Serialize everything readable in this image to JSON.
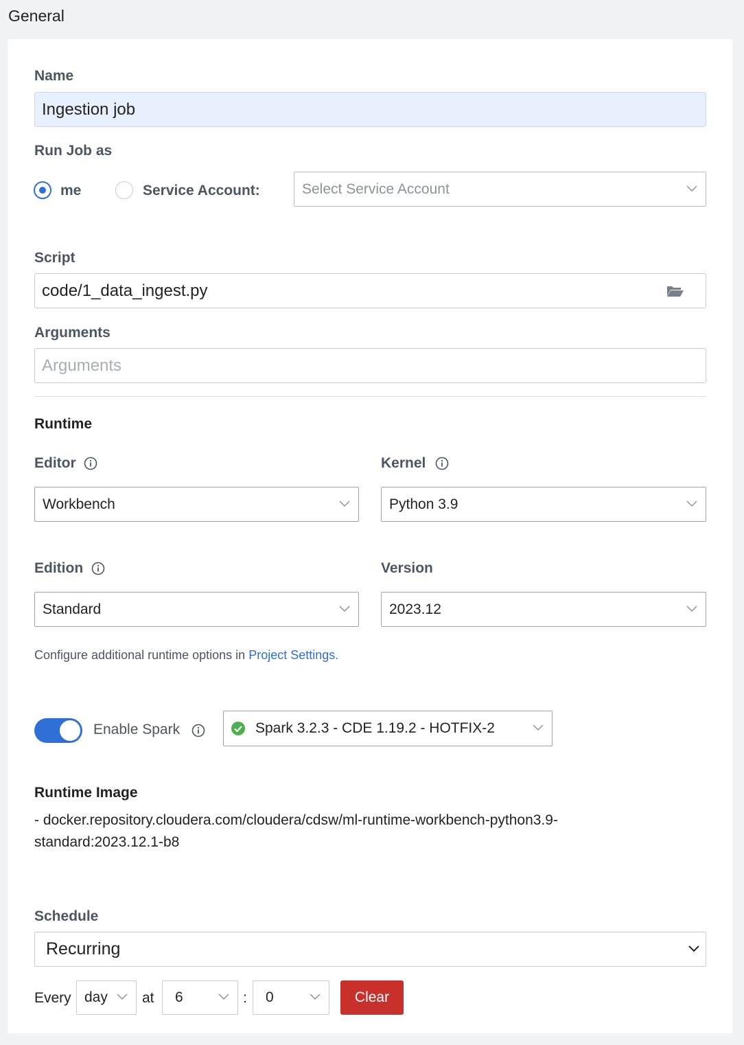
{
  "section": {
    "title": "General"
  },
  "name": {
    "label": "Name",
    "value": "Ingestion job"
  },
  "run_as": {
    "label": "Run Job as",
    "options": [
      {
        "label": "me",
        "selected": true
      },
      {
        "label": "Service Account:",
        "selected": false
      }
    ],
    "service_account_placeholder": "Select Service Account"
  },
  "script": {
    "label": "Script",
    "value": "code/1_data_ingest.py",
    "icon": "folder-open-icon"
  },
  "arguments": {
    "label": "Arguments",
    "placeholder": "Arguments"
  },
  "runtime": {
    "title": "Runtime",
    "editor": {
      "label": "Editor",
      "value": "Workbench"
    },
    "kernel": {
      "label": "Kernel",
      "value": "Python 3.9"
    },
    "edition": {
      "label": "Edition",
      "value": "Standard"
    },
    "version": {
      "label": "Version",
      "value": "2023.12"
    },
    "note_prefix": "Configure additional runtime options in ",
    "note_link": "Project Settings",
    "note_suffix": "."
  },
  "spark": {
    "enabled": true,
    "label": "Enable Spark",
    "value": "Spark 3.2.3 - CDE 1.19.2 - HOTFIX-2",
    "status_color": "#4caf50"
  },
  "runtime_image": {
    "title": "Runtime Image",
    "line1": "- docker.repository.cloudera.com/cloudera/cdsw/ml-runtime-workbench-python3.9-",
    "line2": "standard:2023.12.1-b8"
  },
  "schedule": {
    "label": "Schedule",
    "value": "Recurring",
    "every_label": "Every",
    "period": "day",
    "at_label": "at",
    "hour": "6",
    "separator": ":",
    "minute": "0",
    "clear_label": "Clear"
  },
  "colors": {
    "accent": "#2f6fd6",
    "danger": "#c8302b",
    "link": "#2e6ecf"
  }
}
